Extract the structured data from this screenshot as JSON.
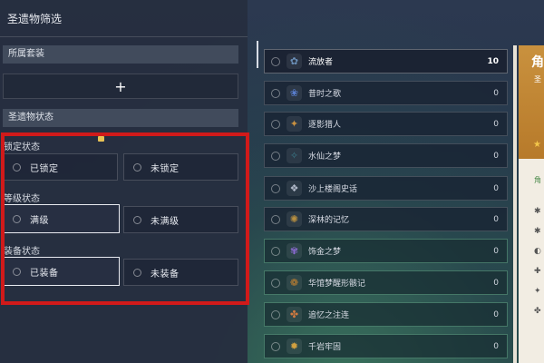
{
  "filter": {
    "title": "圣遗物筛选",
    "set_section": "所属套装",
    "add_symbol": "+",
    "state_section": "圣遗物状态",
    "groups": [
      {
        "label": "锁定状态",
        "options": [
          "已锁定",
          "未锁定"
        ],
        "active": null
      },
      {
        "label": "等级状态",
        "options": [
          "满级",
          "未满级"
        ],
        "active": 0
      },
      {
        "label": "装备状态",
        "options": [
          "已装备",
          "未装备"
        ],
        "active": 0
      }
    ]
  },
  "sets": [
    {
      "name": "流放者",
      "count": "10",
      "icon": "exile-icon",
      "color": "#6a8fb8"
    },
    {
      "name": "昔时之歌",
      "count": "0",
      "icon": "song-of-days-past-icon",
      "color": "#5a7fd0"
    },
    {
      "name": "逐影猎人",
      "count": "0",
      "icon": "shadow-hunter-icon",
      "color": "#c89040"
    },
    {
      "name": "水仙之梦",
      "count": "0",
      "icon": "nymphs-dream-icon",
      "color": "#3a7a8a"
    },
    {
      "name": "沙上楼阁史话",
      "count": "0",
      "icon": "desert-pavilion-icon",
      "color": "#b0b8c8"
    },
    {
      "name": "深林的记忆",
      "count": "0",
      "icon": "deepwood-memories-icon",
      "color": "#b89040"
    },
    {
      "name": "饰金之梦",
      "count": "0",
      "icon": "gilded-dreams-icon",
      "color": "#8a6ad0"
    },
    {
      "name": "华馆梦醒形骸记",
      "count": "0",
      "icon": "husk-of-opulent-dreams-icon",
      "color": "#c08030"
    },
    {
      "name": "追忆之注连",
      "count": "0",
      "icon": "shimenawa-icon",
      "color": "#d07a40"
    },
    {
      "name": "千岩牢固",
      "count": "0",
      "icon": "tenacity-millelith-icon",
      "color": "#d0a040"
    }
  ],
  "detail": {
    "title": "角",
    "subtitle": "圣",
    "green_text": "角"
  },
  "colors": {
    "highlight_frame": "#d11a1a",
    "panel_bg": "#262e40"
  }
}
